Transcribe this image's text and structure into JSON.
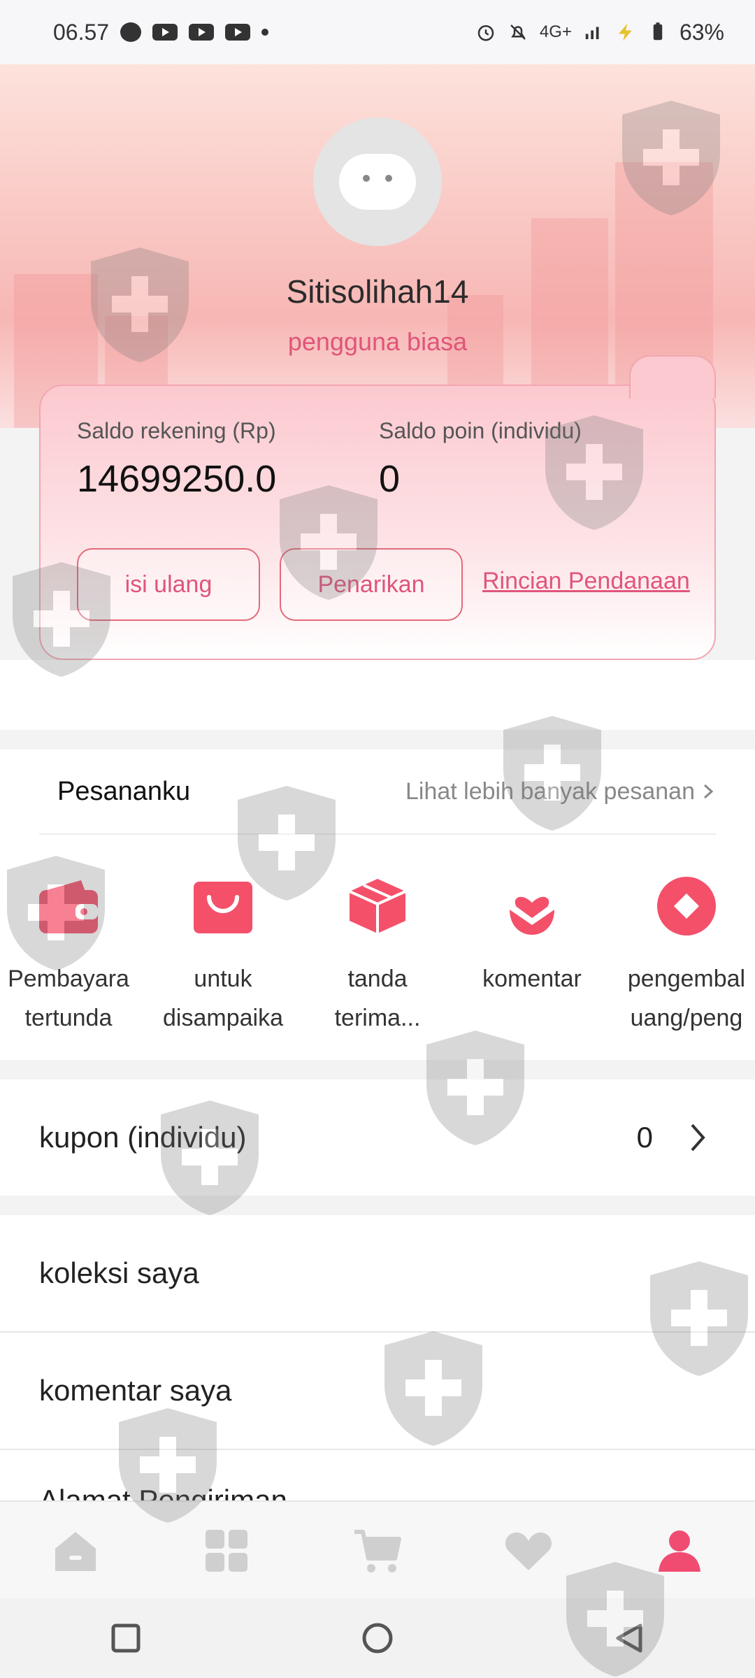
{
  "status": {
    "time": "06.57",
    "network": "4G+",
    "battery": "63%",
    "icons": [
      "chat-icon",
      "youtube-icon",
      "youtube-icon",
      "youtube-icon",
      "dot-icon",
      "alarm-icon",
      "mute-icon",
      "signal-icon",
      "charging-icon",
      "battery-icon"
    ]
  },
  "profile": {
    "username": "Sitisolihah14",
    "user_type": "pengguna biasa"
  },
  "wallet": {
    "balance_label": "Saldo rekening (Rp)",
    "balance_value": "14699250.0",
    "points_label": "Saldo poin (individu)",
    "points_value": "0",
    "topup_label": "isi ulang",
    "withdraw_label": "Penarikan",
    "details_link": "Rincian Pendanaan"
  },
  "orders": {
    "title": "Pesananku",
    "more_label": "Lihat lebih banyak pesanan",
    "items": [
      {
        "line1": "Pembayara",
        "line2": "tertunda"
      },
      {
        "line1": "untuk",
        "line2": "disampaika"
      },
      {
        "line1": "tanda",
        "line2": "terima..."
      },
      {
        "line1": "komentar",
        "line2": ""
      },
      {
        "line1": "pengembal",
        "line2": "uang/peng"
      }
    ]
  },
  "coupon": {
    "label": "kupon (individu)",
    "value": "0"
  },
  "menu": {
    "collection": "koleksi saya",
    "my_reviews": "komentar saya",
    "partial_item": "Alamat Pengiriman"
  },
  "colors": {
    "accent": "#e0557a",
    "icon_red": "#f4506a",
    "nav_active": "#f04c72",
    "nav_inactive": "#cfcfcf"
  }
}
